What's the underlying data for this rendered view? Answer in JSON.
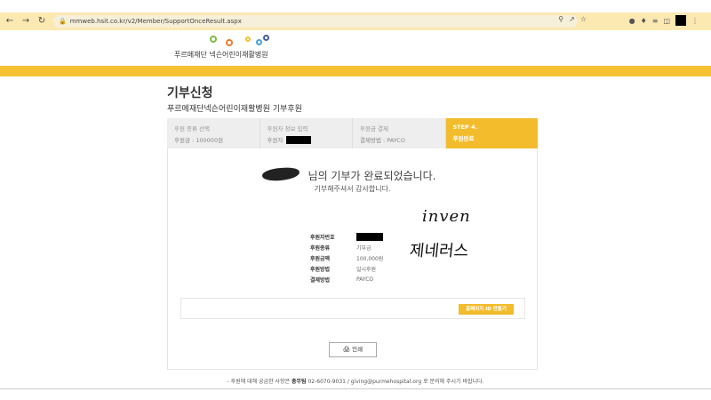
{
  "browser": {
    "url": "mmweb.hsit.co.kr/v2/Member/SupportOnceResult.aspx",
    "back_icon": "arrow-left",
    "forward_icon": "arrow-right",
    "reload_icon": "reload"
  },
  "logo": {
    "text": "푸르메재단 넥슨어린이재활병원",
    "dot_colors": [
      "#7bbd41",
      "#f07b2a",
      "#f5c234",
      "#4aa0d8",
      "#445ea6"
    ]
  },
  "page": {
    "title": "기부신청",
    "subtitle": "푸르메재단넥슨어린이재활병원 기부후원"
  },
  "steps": [
    {
      "title": "후원 종류 선택",
      "value": "후원금 : 100000원"
    },
    {
      "title": "후원자 정보 입력",
      "value": "후원자"
    },
    {
      "title": "후원금 결제",
      "value": "결제방법 : PAYCO"
    },
    {
      "title": "STEP 4.",
      "value": "후원완료"
    }
  ],
  "result": {
    "done_text": "님의 기부가 완료되었습니다.",
    "thanks_text": "기부해주셔서 감사합니다.",
    "handwriting_1": "inven",
    "handwriting_2": "제네러스"
  },
  "info": [
    {
      "label": "후원자번호",
      "value": ""
    },
    {
      "label": "후원종류",
      "value": "기부금"
    },
    {
      "label": "후원금액",
      "value": "100,000원"
    },
    {
      "label": "후원방법",
      "value": "일시후원"
    },
    {
      "label": "결제방법",
      "value": "PAYCO"
    }
  ],
  "buttons": {
    "homepage_id": "홈페이지 ID 만들기",
    "print": "인쇄"
  },
  "footer": {
    "prefix": "- 후원에 대해 궁금한 사항은",
    "team": "총무팀",
    "contact": "02-6070-9031 / giving@purmehospital.org",
    "suffix": "로 문의해 주시기 바랍니다."
  },
  "colors": {
    "accent": "#f2bc2c",
    "band": "#f5c234",
    "browser": "#fce9b2"
  }
}
